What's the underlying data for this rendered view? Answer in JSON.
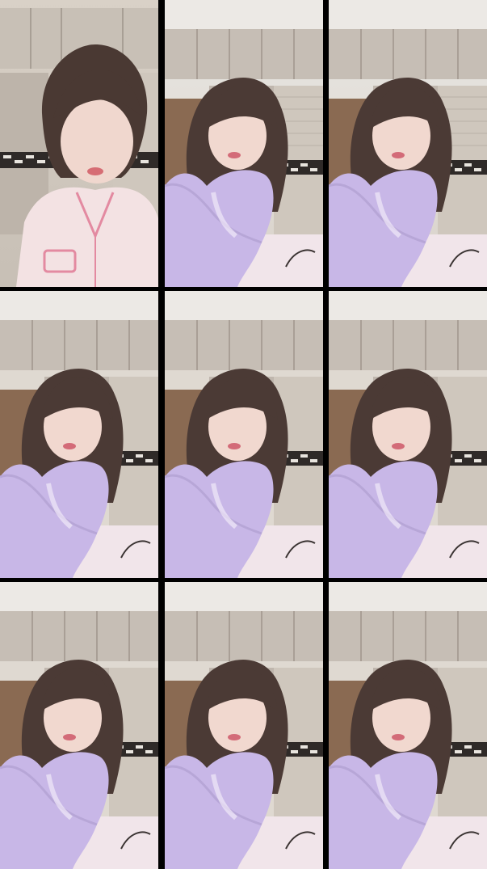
{
  "layout": {
    "columns": 3,
    "rows": 3
  },
  "tiles": [
    {
      "variant": "pink-pajamas",
      "top_label": ""
    },
    {
      "variant": "lavender-cardigan",
      "top_label": ""
    },
    {
      "variant": "lavender-cardigan",
      "top_label": ""
    },
    {
      "variant": "lavender-cardigan",
      "top_label": ""
    },
    {
      "variant": "lavender-cardigan",
      "top_label": ""
    },
    {
      "variant": "lavender-cardigan",
      "top_label": ""
    },
    {
      "variant": "lavender-cardigan",
      "top_label": ""
    },
    {
      "variant": "lavender-cardigan",
      "top_label": ""
    },
    {
      "variant": "lavender-cardigan",
      "top_label": ""
    }
  ],
  "colors": {
    "background_gap": "#000000",
    "ceiling": "#e9e7e3",
    "cabinet": "#bfb7ae",
    "cabinet_dark": "#a99f96",
    "door_wood": "#8a6a52",
    "hair": "#4b3a35",
    "skin": "#f1d8cf",
    "cardigan": "#c8b7e7",
    "pajamas": "#f3e2e3",
    "bedding": "#f1e5ea"
  }
}
